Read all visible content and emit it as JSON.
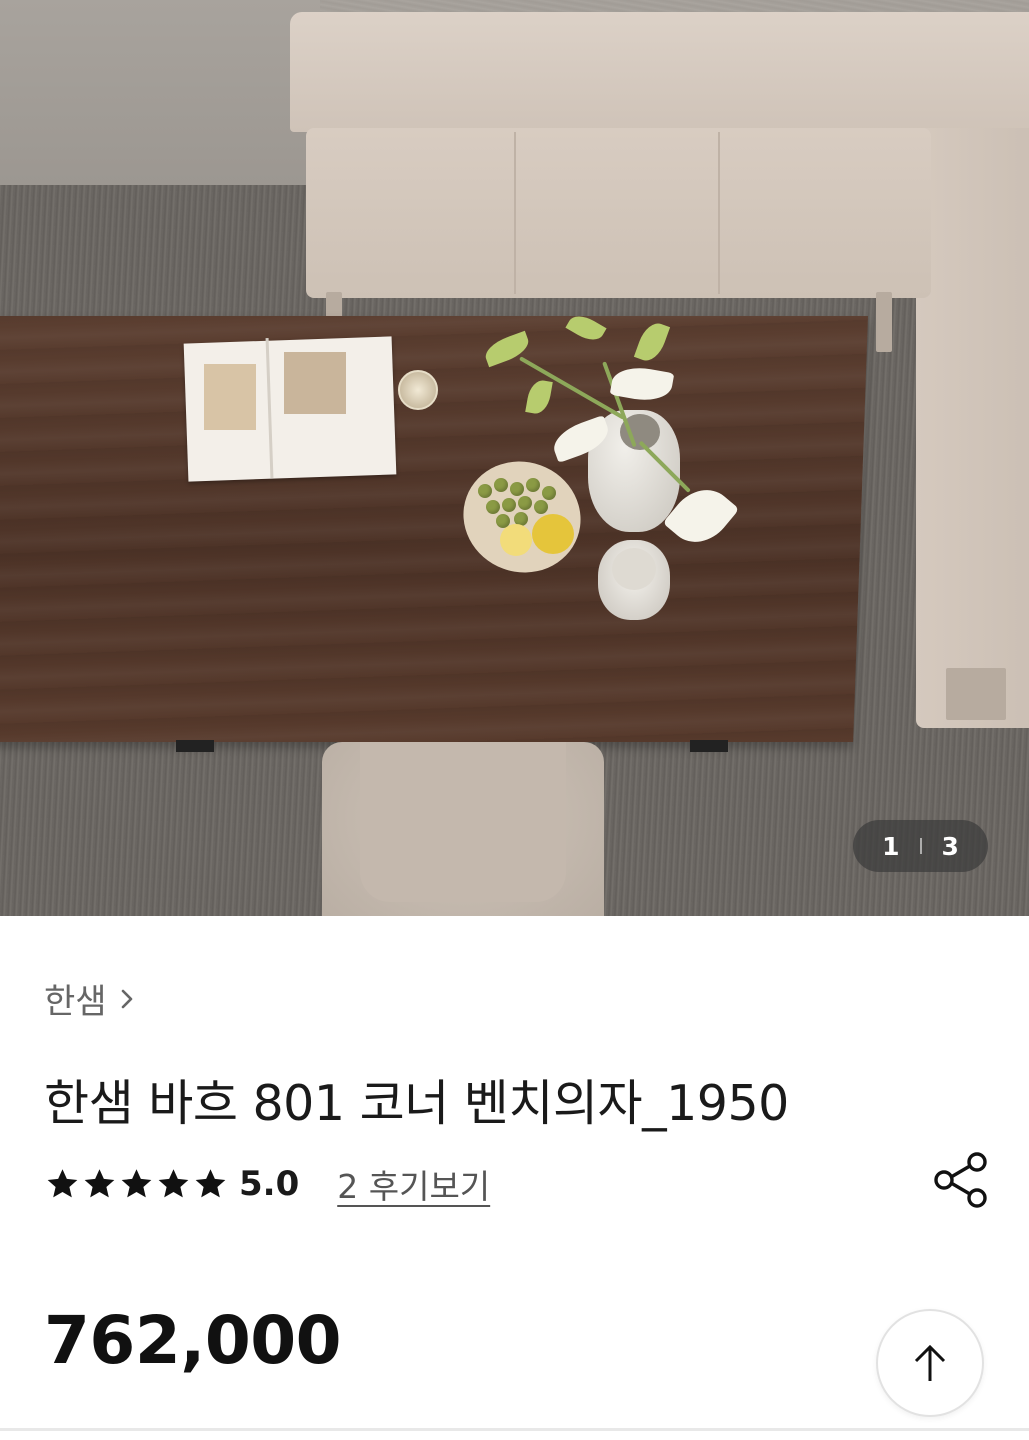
{
  "gallery": {
    "current_page": "1",
    "total_pages": "3",
    "image_icon": "product-photo"
  },
  "product": {
    "brand": "한샘",
    "title": "한샘 바흐 801 코너 벤치의자_1950",
    "rating_stars": 5,
    "rating_value": "5.0",
    "reviews_label": "2 후기보기",
    "price": "762,000"
  },
  "icons": {
    "brand_chevron": "chevron-right-icon",
    "star": "star-icon",
    "share": "share-icon",
    "scroll_top": "arrow-up-icon"
  },
  "colors": {
    "text_primary": "#1a1a1a",
    "text_secondary": "#666666",
    "pager_bg": "#3c3c3c"
  }
}
